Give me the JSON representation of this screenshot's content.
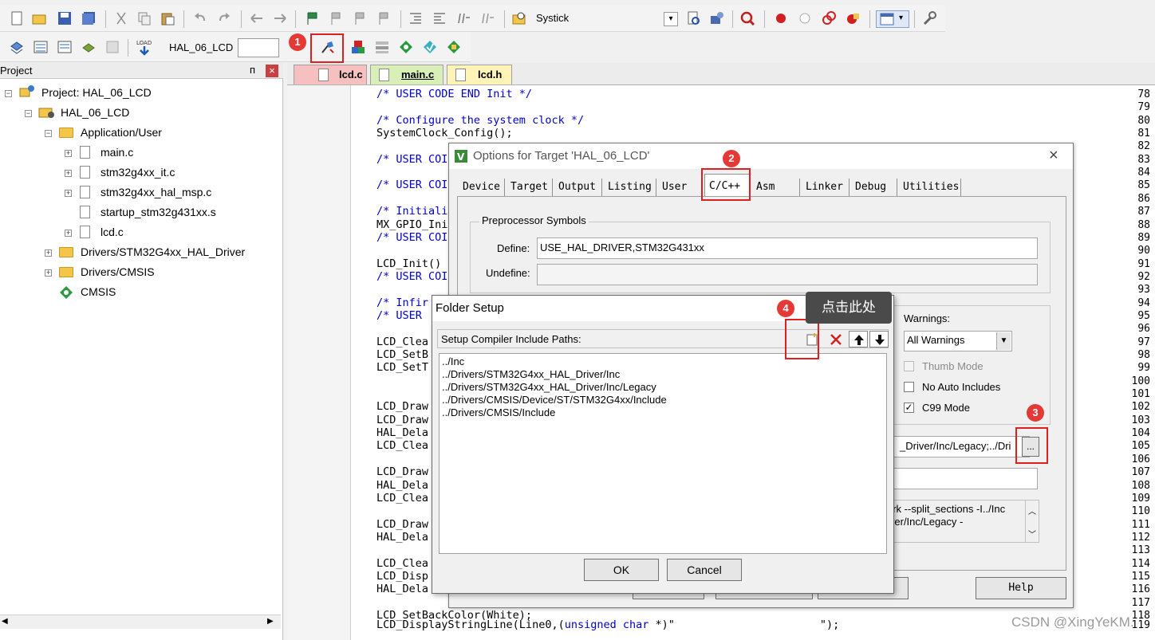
{
  "toolbar": {
    "target_dropdown": "Systick",
    "target_name": "HAL_06_LCD"
  },
  "project": {
    "panel_title": "Project",
    "pin": "ᴨ",
    "close": "×",
    "tree": [
      {
        "label": "Project: HAL_06_LCD"
      },
      {
        "label": "HAL_06_LCD"
      },
      {
        "label": "Application/User"
      },
      {
        "label": "main.c"
      },
      {
        "label": "stm32g4xx_it.c"
      },
      {
        "label": "stm32g4xx_hal_msp.c"
      },
      {
        "label": "startup_stm32g431xx.s"
      },
      {
        "label": "lcd.c"
      },
      {
        "label": "Drivers/STM32G4xx_HAL_Driver"
      },
      {
        "label": "Drivers/CMSIS"
      },
      {
        "label": "CMSIS"
      }
    ]
  },
  "editor": {
    "tabs": [
      "lcd.c",
      "main.c",
      "lcd.h"
    ],
    "lines": [
      {
        "n": "78",
        "t": "/* USER CODE END Init */",
        "c": true
      },
      {
        "n": "79",
        "t": "",
        "c": false
      },
      {
        "n": "80",
        "t": "/* Configure the system clock */",
        "c": true
      },
      {
        "n": "81",
        "t": "SystemClock_Config();",
        "c": false
      },
      {
        "n": "82",
        "t": "",
        "c": false
      },
      {
        "n": "83",
        "t": "/* USER COI",
        "c": true
      },
      {
        "n": "84",
        "t": "",
        "c": false
      },
      {
        "n": "85",
        "t": "/* USER COI",
        "c": true
      },
      {
        "n": "86",
        "t": "",
        "c": false
      },
      {
        "n": "87",
        "t": "/* Initiali",
        "c": true
      },
      {
        "n": "88",
        "t": "MX_GPIO_Ini",
        "c": false
      },
      {
        "n": "89",
        "t": "/* USER COI",
        "c": true
      },
      {
        "n": "90",
        "t": "",
        "c": false
      },
      {
        "n": "91",
        "t": "LCD_Init()",
        "c": false
      },
      {
        "n": "92",
        "t": "/* USER COI",
        "c": true
      },
      {
        "n": "93",
        "t": "",
        "c": false
      },
      {
        "n": "94",
        "t": "/* Infir",
        "c": true
      },
      {
        "n": "95",
        "t": "/* USER",
        "c": true
      },
      {
        "n": "96",
        "t": "",
        "c": false
      },
      {
        "n": "97",
        "t": "LCD_Clea",
        "c": false
      },
      {
        "n": "98",
        "t": "LCD_SetB",
        "c": false
      },
      {
        "n": "99",
        "t": "LCD_SetT",
        "c": false
      },
      {
        "n": "100",
        "t": "",
        "c": false
      },
      {
        "n": "101",
        "t": "",
        "c": false
      },
      {
        "n": "102",
        "t": "LCD_Draw",
        "c": false
      },
      {
        "n": "103",
        "t": "LCD_Draw",
        "c": false
      },
      {
        "n": "104",
        "t": "HAL_Dela",
        "c": false
      },
      {
        "n": "105",
        "t": "LCD_Clea",
        "c": false
      },
      {
        "n": "106",
        "t": "",
        "c": false
      },
      {
        "n": "107",
        "t": "LCD_Draw",
        "c": false
      },
      {
        "n": "108",
        "t": "HAL_Dela",
        "c": false
      },
      {
        "n": "109",
        "t": "LCD_Clea",
        "c": false
      },
      {
        "n": "110",
        "t": "",
        "c": false
      },
      {
        "n": "111",
        "t": "LCD_Draw",
        "c": false
      },
      {
        "n": "112",
        "t": "HAL_Dela",
        "c": false
      },
      {
        "n": "113",
        "t": "",
        "c": false
      },
      {
        "n": "114",
        "t": "LCD_Clea",
        "c": false
      },
      {
        "n": "115",
        "t": "LCD_Disp",
        "c": false
      },
      {
        "n": "116",
        "t": "HAL_Dela",
        "c": false
      },
      {
        "n": "117",
        "t": "",
        "c": false
      },
      {
        "n": "118",
        "t": "LCD_SetBackColor(White);",
        "c": false
      }
    ],
    "line119_a": "LCD_DisplayStringLine(Line0,(",
    "line119_kw": "unsigned char",
    "line119_b": " *)\"",
    "line119_c": "\");",
    "line119_n": "119"
  },
  "options": {
    "title": "Options for Target 'HAL_06_LCD'",
    "close": "×",
    "tabs": [
      "Device",
      "Target",
      "Output",
      "Listing",
      "User",
      "C/C++",
      "Asm",
      "Linker",
      "Debug",
      "Utilities"
    ],
    "preprocessor_label": "Preprocessor Symbols",
    "define_label": "Define:",
    "define_value": "USE_HAL_DRIVER,STM32G431xx",
    "undefine_label": "Undefine:",
    "warnings_label": "Warnings:",
    "warnings_value": "All Warnings",
    "thumb_mode": "Thumb Mode",
    "no_auto_includes": "No Auto Includes",
    "c99_mode": "C99 Mode",
    "include_paths_value": "_Driver/Inc/Legacy;../Dri",
    "browse": "...",
    "misc_text_1": "ork --split_sections -I../Inc",
    "misc_text_2": "iver/Inc/Legacy -",
    "help": "Help"
  },
  "folder_setup": {
    "title": "Folder Setup",
    "paths_label": "Setup Compiler Include Paths:",
    "paths": [
      "../Inc",
      "../Drivers/STM32G4xx_HAL_Driver/Inc",
      "../Drivers/STM32G4xx_HAL_Driver/Inc/Legacy",
      "../Drivers/CMSIS/Device/ST/STM32G4xx/Include",
      "../Drivers/CMSIS/Include"
    ],
    "ok": "OK",
    "cancel": "Cancel"
  },
  "callouts": {
    "b1": "1",
    "b2": "2",
    "b3": "3",
    "b4": "4",
    "tooltip": "点击此处"
  },
  "watermark": "CSDN @XingYeKM."
}
